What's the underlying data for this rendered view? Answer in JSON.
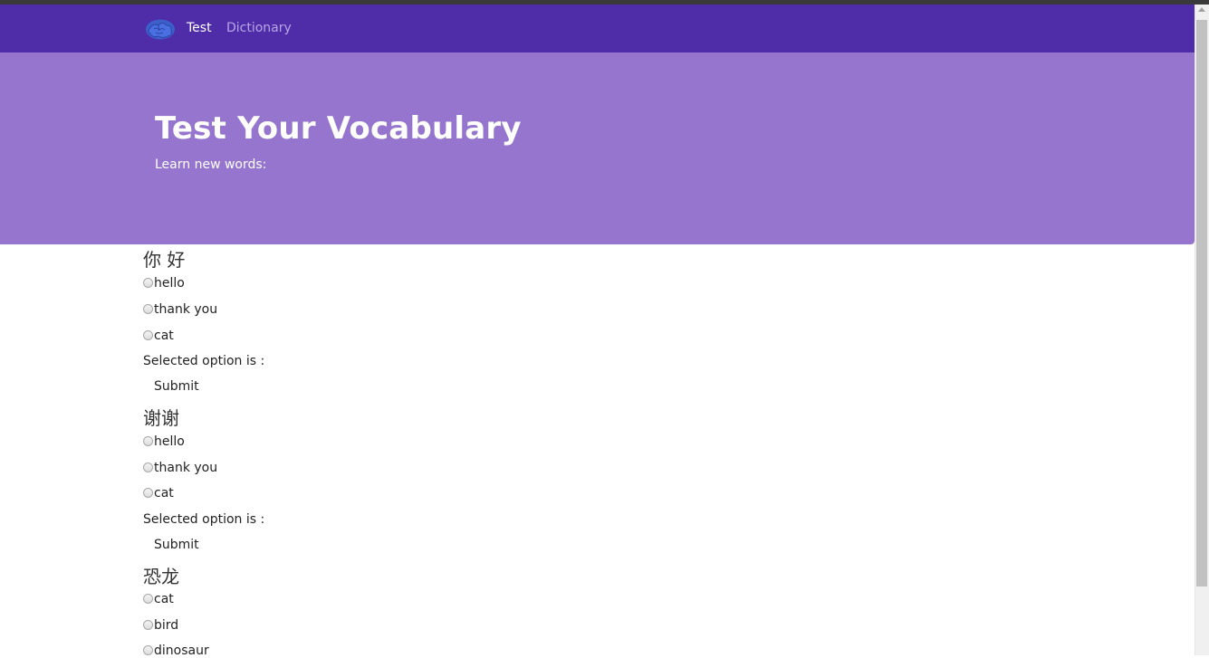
{
  "nav": {
    "logo_icon": "brain-logo-icon",
    "items": [
      {
        "label": "Test",
        "active": true
      },
      {
        "label": "Dictionary",
        "active": false
      }
    ],
    "bg_color": "#4f2ca8"
  },
  "hero": {
    "title": "Test Your Vocabulary",
    "subtitle": "Learn new words:",
    "bg_color": "#9575cd"
  },
  "questions": [
    {
      "word": "你 好",
      "options": [
        "hello",
        "thank you",
        "cat"
      ],
      "selected_label": "Selected option is :",
      "submit_label": "Submit"
    },
    {
      "word": "谢谢",
      "options": [
        "hello",
        "thank you",
        "cat"
      ],
      "selected_label": "Selected option is :",
      "submit_label": "Submit"
    },
    {
      "word": "恐龙",
      "options": [
        "cat",
        "bird",
        "dinosaur"
      ]
    }
  ]
}
